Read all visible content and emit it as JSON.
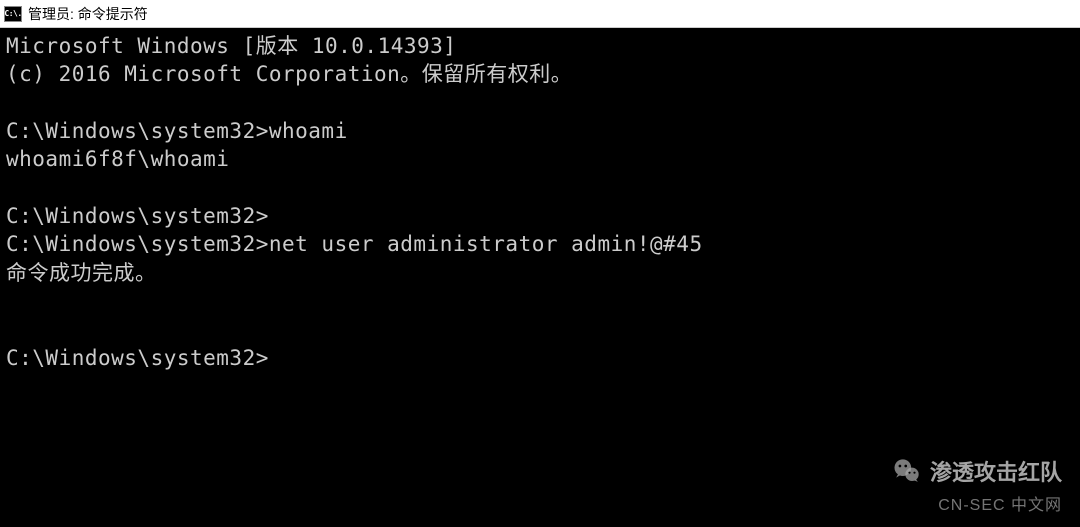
{
  "title_bar": {
    "icon_label": "C:\\.",
    "title": "管理员: 命令提示符"
  },
  "terminal_lines": [
    "Microsoft Windows [版本 10.0.14393]",
    "(c) 2016 Microsoft Corporation。保留所有权利。",
    "",
    "C:\\Windows\\system32>whoami",
    "whoami6f8f\\whoami",
    "",
    "C:\\Windows\\system32>",
    "C:\\Windows\\system32>net user administrator admin!@#45",
    "命令成功完成。",
    "",
    "",
    "C:\\Windows\\system32>"
  ],
  "watermark": {
    "title": "渗透攻击红队",
    "subtitle": "CN-SEC 中文网"
  }
}
